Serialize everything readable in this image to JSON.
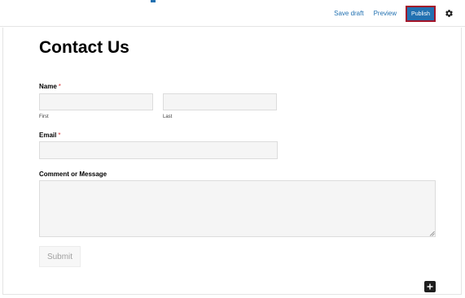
{
  "toolbar": {
    "save_draft_label": "Save draft",
    "preview_label": "Preview",
    "publish_label": "Publish",
    "settings_icon": "gear-icon",
    "accent_color": "#2271b1",
    "publish_highlight_color": "#a3152a"
  },
  "editor": {
    "title": "Contact Us",
    "inserter_icon": "plus-icon"
  },
  "form": {
    "name": {
      "label": "Name",
      "required_mark": "*",
      "first_sublabel": "First",
      "last_sublabel": "Last",
      "first_value": "",
      "last_value": ""
    },
    "email": {
      "label": "Email",
      "required_mark": "*",
      "value": ""
    },
    "comment": {
      "label": "Comment or Message",
      "value": ""
    },
    "submit_label": "Submit",
    "required_color": "#d63638"
  }
}
